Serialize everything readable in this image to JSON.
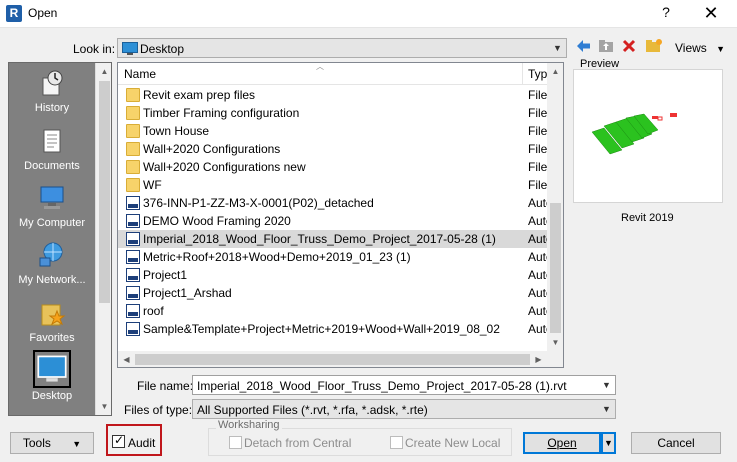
{
  "window": {
    "title": "Open",
    "help": "?",
    "close": "✕",
    "logo": "R"
  },
  "lookin": {
    "label": "Look in:",
    "value": "Desktop"
  },
  "toolbar": {
    "views_label": "Views",
    "icons": [
      "back-arrow-icon",
      "up-folder-icon",
      "delete-icon",
      "new-folder-icon"
    ]
  },
  "places": [
    {
      "label": "History",
      "icon": "history-icon"
    },
    {
      "label": "Documents",
      "icon": "documents-icon"
    },
    {
      "label": "My Computer",
      "icon": "computer-icon"
    },
    {
      "label": "My Network...",
      "icon": "network-icon"
    },
    {
      "label": "Favorites",
      "icon": "favorites-icon"
    },
    {
      "label": "Desktop",
      "icon": "desktop-icon",
      "selected": true
    }
  ],
  "filelist": {
    "col_name": "Name",
    "col_type": "Type",
    "rows": [
      {
        "name": "Revit exam prep files",
        "type": "File f",
        "kind": "folder"
      },
      {
        "name": "Timber Framing configuration",
        "type": "File f",
        "kind": "folder"
      },
      {
        "name": "Town House",
        "type": "File f",
        "kind": "folder"
      },
      {
        "name": "Wall+2020 Configurations",
        "type": "File f",
        "kind": "folder"
      },
      {
        "name": "Wall+2020 Configurations new",
        "type": "File f",
        "kind": "folder"
      },
      {
        "name": "WF",
        "type": "File f",
        "kind": "folder"
      },
      {
        "name": "376-INN-P1-ZZ-M3-X-0001(P02)_detached",
        "type": "Auto",
        "kind": "rvt"
      },
      {
        "name": "DEMO Wood Framing 2020",
        "type": "Auto",
        "kind": "rvt"
      },
      {
        "name": "Imperial_2018_Wood_Floor_Truss_Demo_Project_2017-05-28 (1)",
        "type": "Auto",
        "kind": "rvt",
        "selected": true
      },
      {
        "name": "Metric+Roof+2018+Wood+Demo+2019_01_23 (1)",
        "type": "Auto",
        "kind": "rvt"
      },
      {
        "name": "Project1",
        "type": "Auto",
        "kind": "rvt"
      },
      {
        "name": "Project1_Arshad",
        "type": "Auto",
        "kind": "rvt"
      },
      {
        "name": "roof",
        "type": "Auto",
        "kind": "rvt"
      },
      {
        "name": "Sample&Template+Project+Metric+2019+Wood+Wall+2019_08_02",
        "type": "Auto",
        "kind": "rvt"
      }
    ]
  },
  "preview": {
    "label": "Preview",
    "version": "Revit 2019"
  },
  "filename": {
    "label": "File name:",
    "value": "Imperial_2018_Wood_Floor_Truss_Demo_Project_2017-05-28 (1).rvt"
  },
  "filetype": {
    "label": "Files of type:",
    "value": "All Supported Files  (*.rvt, *.rfa, *.adsk, *.rte)"
  },
  "bottom": {
    "tools_label": "Tools",
    "audit_label": "Audit",
    "audit_checked": true,
    "worksharing_label": "Worksharing",
    "detach_label": "Detach from Central",
    "create_local_label": "Create New Local",
    "open_label": "Open",
    "cancel_label": "Cancel"
  },
  "colors": {
    "selection": "#d9d9d9",
    "accent": "#0078d7",
    "highlight_box": "#c0161b",
    "places_bg": "#808080"
  }
}
